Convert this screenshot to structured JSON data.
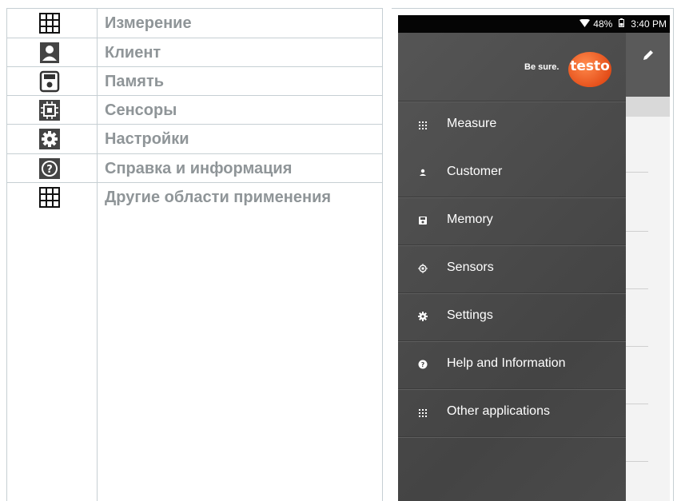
{
  "table": {
    "rows": [
      {
        "icon": "grid-icon",
        "label": "Измерение"
      },
      {
        "icon": "person-icon",
        "label": "Клиент"
      },
      {
        "icon": "floppy-icon",
        "label": "Память"
      },
      {
        "icon": "chip-icon",
        "label": "Сенсоры"
      },
      {
        "icon": "gear-icon",
        "label": "Настройки"
      },
      {
        "icon": "help-icon",
        "label": "Справка и информация"
      },
      {
        "icon": "grid-icon",
        "label": "Другие области применения"
      }
    ]
  },
  "phone": {
    "status": {
      "battery": "48%",
      "time": "3:40 PM",
      "icons": [
        "wifi-icon",
        "battery-icon"
      ]
    },
    "brand": {
      "slogan": "Be sure.",
      "logo_text": "testo",
      "logo_color": "#e5501b"
    },
    "edit_icon": "pencil-icon",
    "menu": [
      {
        "icon": "grid-icon",
        "label": "Measure"
      },
      {
        "icon": "person-icon",
        "label": "Customer"
      },
      {
        "icon": "floppy-icon",
        "label": "Memory"
      },
      {
        "icon": "chip-icon",
        "label": "Sensors"
      },
      {
        "icon": "gear-icon",
        "label": "Settings"
      },
      {
        "icon": "help-icon",
        "label": "Help and Information"
      },
      {
        "icon": "grid-icon",
        "label": "Other applications"
      }
    ]
  }
}
